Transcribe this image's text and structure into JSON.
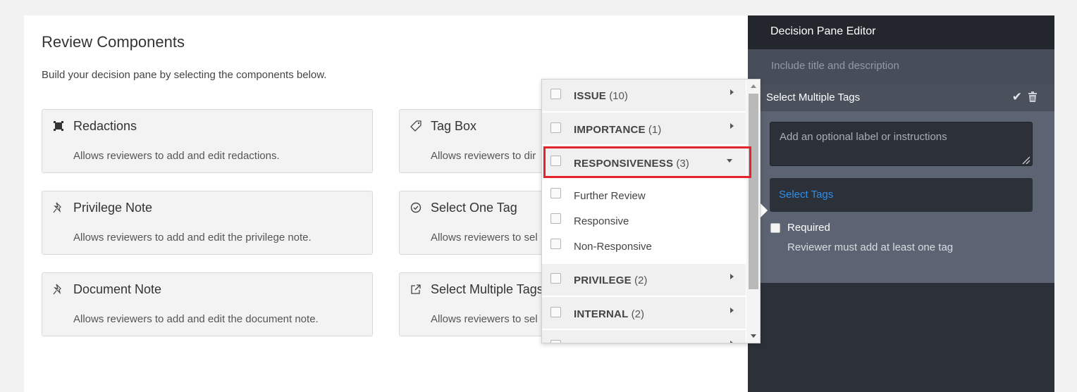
{
  "main": {
    "title": "Review Components",
    "description": "Build your decision pane by selecting the components below.",
    "components": [
      {
        "title": "Redactions",
        "description": "Allows reviewers to add and edit redactions.",
        "icon": "redaction-icon"
      },
      {
        "title": "Tag Box",
        "description": "Allows reviewers to dir",
        "icon": "tag-icon"
      },
      {
        "title": "Privilege Note",
        "description": "Allows reviewers to add and edit the privilege note.",
        "icon": "pin-icon"
      },
      {
        "title": "Select One Tag",
        "description": "Allows reviewers to sel",
        "icon": "check-circle-icon"
      },
      {
        "title": "Document Note",
        "description": "Allows reviewers to add and edit the document note.",
        "icon": "pin-icon"
      },
      {
        "title": "Select Multiple Tags",
        "description": "Allows reviewers to sel",
        "icon": "external-link-icon"
      }
    ]
  },
  "dropdown": {
    "items": [
      {
        "label": "ISSUE",
        "count": "(10)",
        "type": "parent",
        "expanded": false
      },
      {
        "label": "IMPORTANCE",
        "count": "(1)",
        "type": "parent",
        "expanded": false
      },
      {
        "label": "RESPONSIVENESS",
        "count": "(3)",
        "type": "parent",
        "expanded": true
      },
      {
        "label": "Further Review",
        "type": "child"
      },
      {
        "label": "Responsive",
        "type": "child"
      },
      {
        "label": "Non-Responsive",
        "type": "child"
      },
      {
        "label": "PRIVILEGE",
        "count": "(2)",
        "type": "parent",
        "expanded": false
      },
      {
        "label": "INTERNAL",
        "count": "(2)",
        "type": "parent",
        "expanded": false
      }
    ],
    "highlight_color": "#e3242b"
  },
  "right_panel": {
    "title": "Decision Pane Editor",
    "include_placeholder": "Include title and description",
    "editor": {
      "title": "Select Multiple Tags",
      "label_placeholder": "Add an optional label or instructions",
      "select_tags": "Select Tags",
      "required_label": "Required",
      "required_hint": "Reviewer must add at least one tag"
    }
  },
  "colors": {
    "link": "#2f8fe8",
    "panel_dark": "#2c3038",
    "editor_bg": "#5c6473"
  }
}
